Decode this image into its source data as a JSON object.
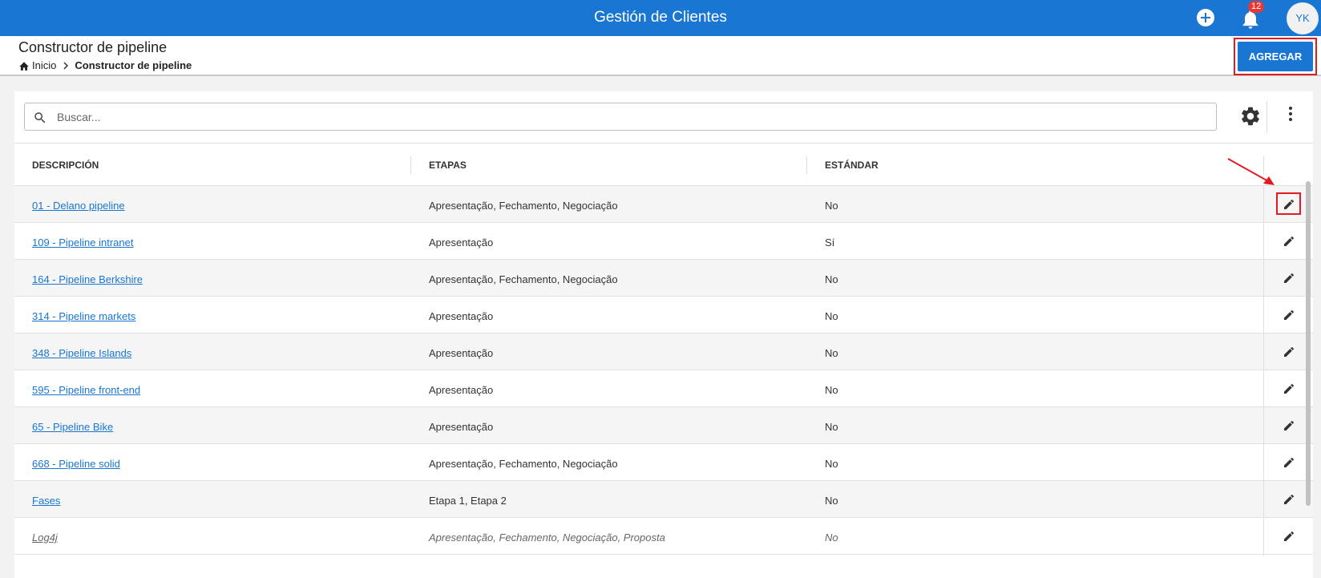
{
  "header": {
    "app_title": "Gestión de Clientes",
    "notification_count": "12",
    "user_initials": "YK",
    "icons": [
      "plus-circle-icon",
      "bell-icon"
    ]
  },
  "subheader": {
    "page_title": "Constructor de pipeline",
    "breadcrumb": {
      "home_label": "Inicio",
      "current_label": "Constructor de pipeline"
    },
    "add_button_label": "AGREGAR"
  },
  "toolbar": {
    "search_placeholder": "Buscar...",
    "icons": [
      "search-icon",
      "gear-icon",
      "more-vert-icon"
    ]
  },
  "table": {
    "columns": [
      "DESCRIPCIÓN",
      "ETAPAS",
      "ESTÁNDAR"
    ],
    "rows": [
      {
        "descripcion": "01 - Delano pipeline",
        "etapas": "Apresentação, Fechamento, Negociação",
        "estandar": "No"
      },
      {
        "descripcion": "109 - Pipeline intranet",
        "etapas": "Apresentação",
        "estandar": "Sí"
      },
      {
        "descripcion": "164 - Pipeline Berkshire",
        "etapas": "Apresentação, Fechamento, Negociação",
        "estandar": "No"
      },
      {
        "descripcion": "314 - Pipeline markets",
        "etapas": "Apresentação",
        "estandar": "No"
      },
      {
        "descripcion": "348 - Pipeline Islands",
        "etapas": "Apresentação",
        "estandar": "No"
      },
      {
        "descripcion": "595 - Pipeline front-end",
        "etapas": "Apresentação",
        "estandar": "No"
      },
      {
        "descripcion": "65 - Pipeline Bike",
        "etapas": "Apresentação",
        "estandar": "No"
      },
      {
        "descripcion": "668 - Pipeline solid",
        "etapas": "Apresentação, Fechamento, Negociação",
        "estandar": "No"
      },
      {
        "descripcion": "Fases",
        "etapas": "Etapa 1, Etapa 2",
        "estandar": "No"
      },
      {
        "descripcion": "Log4j",
        "etapas": "Apresentação, Fechamento, Negociação, Proposta",
        "estandar": "No"
      }
    ]
  },
  "colors": {
    "primary": "#1976d2",
    "annotation_red": "#e11b22",
    "badge_red": "#e53935"
  }
}
